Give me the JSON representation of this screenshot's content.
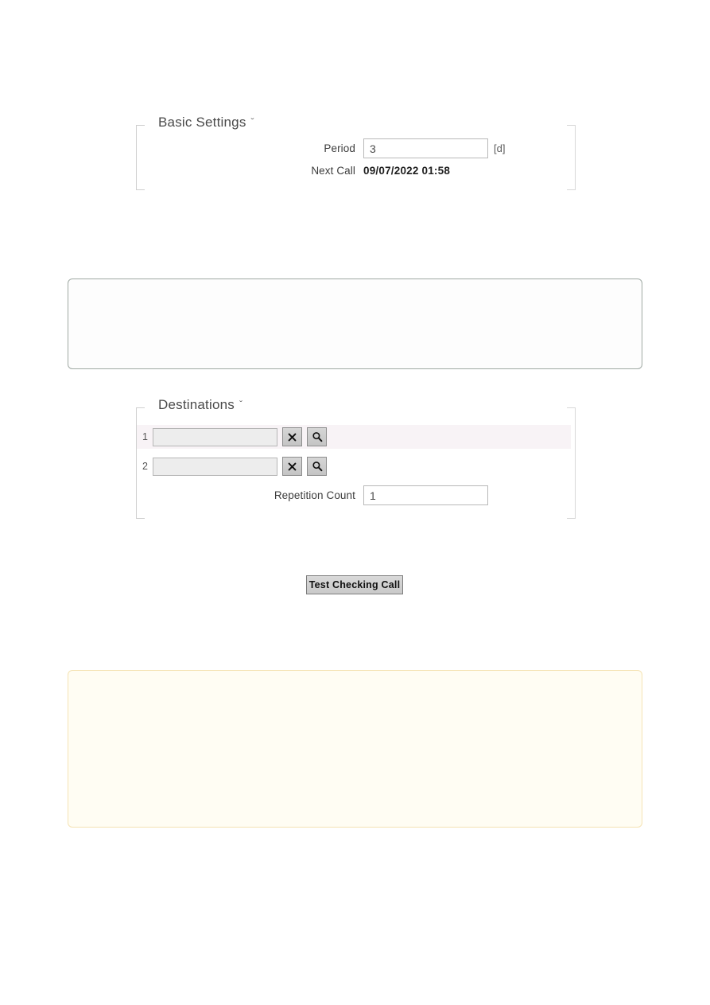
{
  "page": {
    "background_color": "#ffffff"
  },
  "basic_settings": {
    "title": "Basic Settings",
    "chevron": "ˇ",
    "period": {
      "label": "Period",
      "value": "3",
      "placeholder": "",
      "unit": "[d]"
    },
    "next_call": {
      "label": "Next Call",
      "value": "09/07/2022 01:58"
    }
  },
  "notice_box": {
    "border_color": "#9fa9a3",
    "background_color": "#fdfdfd",
    "text": ""
  },
  "destinations": {
    "title": "Destinations",
    "chevron": "ˇ",
    "highlight_color": "#f8f3f6",
    "rows": [
      {
        "index": "1",
        "value": "",
        "placeholder": "",
        "clear_label": "×",
        "clear_icon": "close-icon",
        "search_icon": "search-icon",
        "highlighted": true
      },
      {
        "index": "2",
        "value": "",
        "placeholder": "",
        "clear_label": "×",
        "clear_icon": "close-icon",
        "search_icon": "search-icon",
        "highlighted": false
      }
    ],
    "repetition_count": {
      "label": "Repetition Count",
      "value": "1",
      "placeholder": ""
    }
  },
  "test_button": {
    "label": "Test Checking Call"
  },
  "warning_box": {
    "border_color": "#f5e3b3",
    "background_color": "#fffdf3",
    "text": ""
  }
}
